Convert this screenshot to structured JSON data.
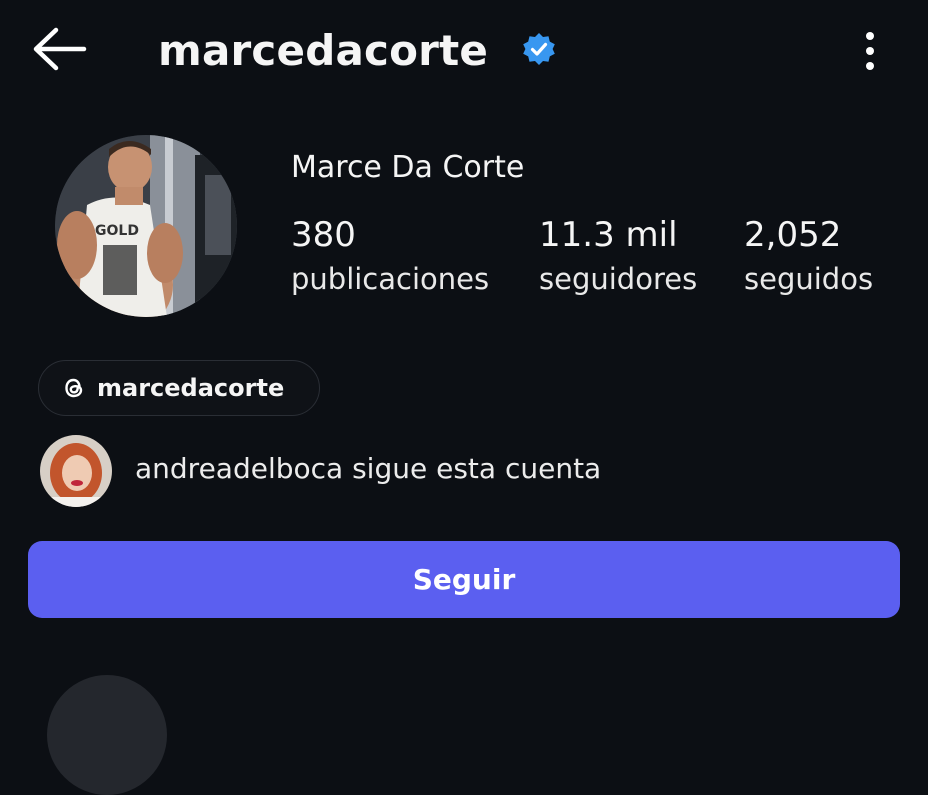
{
  "header": {
    "username": "marcedacorte",
    "verified": true,
    "back_icon": "arrow-left-icon",
    "menu_icon": "more-vertical-icon"
  },
  "profile": {
    "full_name": "Marce Da Corte",
    "stats": [
      {
        "value": "380",
        "label": "publicaciones"
      },
      {
        "value": "11.3 mil",
        "label": "seguidores"
      },
      {
        "value": "2,052",
        "label": "seguidos"
      }
    ]
  },
  "threads": {
    "label": "marcedacorte",
    "icon": "threads-icon"
  },
  "followed_by": {
    "text": "andreadelboca sigue esta cuenta"
  },
  "actions": {
    "follow_label": "Seguir"
  },
  "colors": {
    "background": "#0c0f14",
    "follow_button": "#5b5ff0",
    "verified_badge": "#3897f0"
  }
}
